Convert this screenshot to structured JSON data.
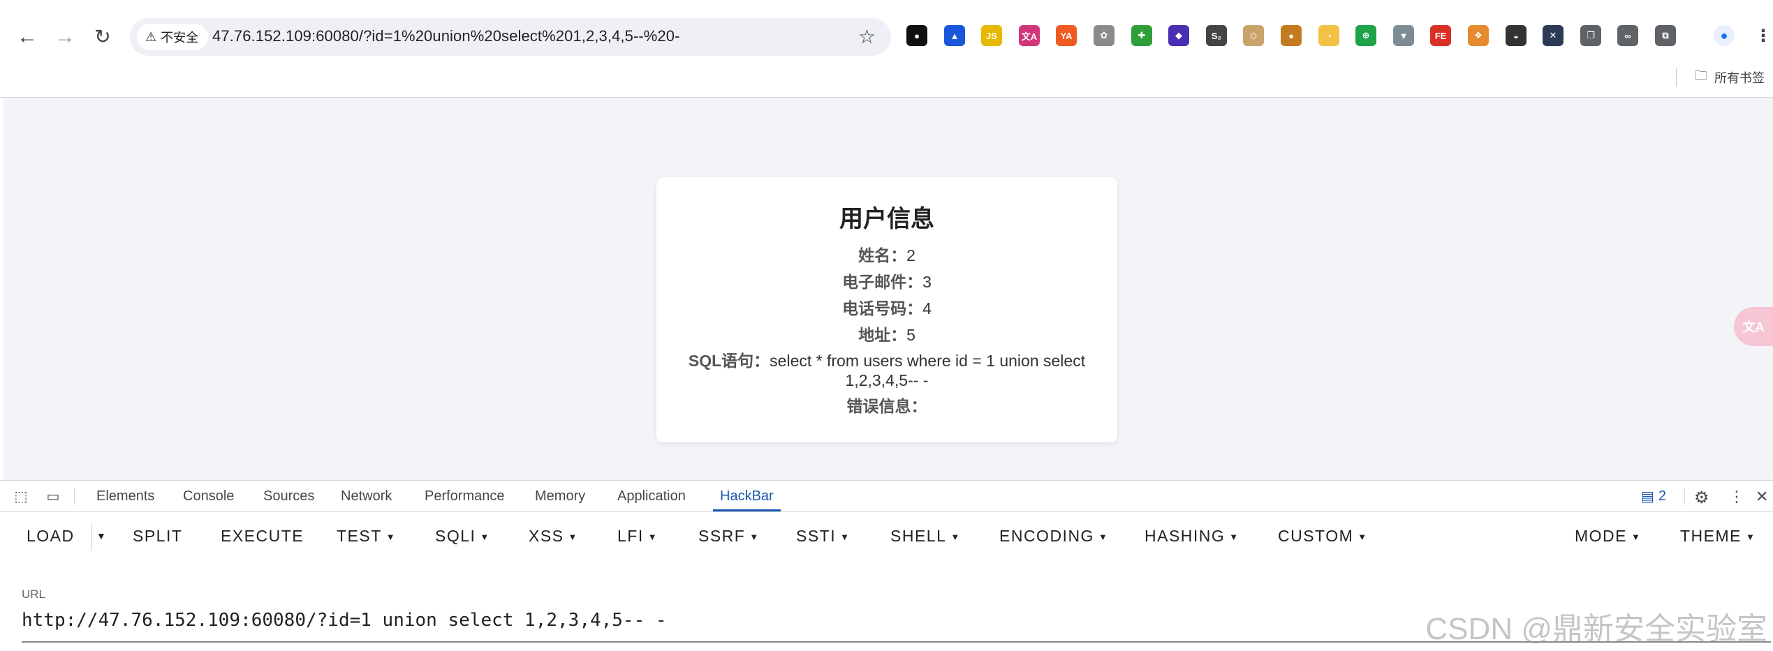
{
  "browser": {
    "security_label": "不安全",
    "url": "47.76.152.109:60080/?id=1%20union%20select%201,2,3,4,5--%20-",
    "bookmarks_label": "所有书签",
    "extensions": [
      {
        "name": "circle-ext-icon",
        "glyph": "●",
        "color": "#111111"
      },
      {
        "name": "triangle-ext-icon",
        "glyph": "▲",
        "color": "#1a56db"
      },
      {
        "name": "js-ext-icon",
        "glyph": "JS",
        "color": "#e6b800"
      },
      {
        "name": "translate-ext-icon",
        "glyph": "文A",
        "color": "#d1367a"
      },
      {
        "name": "ya-ext-icon",
        "glyph": "YA",
        "color": "#f05a22"
      },
      {
        "name": "gecko-ext-icon",
        "glyph": "✿",
        "color": "#8a8a8a"
      },
      {
        "name": "plus-ext-icon",
        "glyph": "✚",
        "color": "#2e9e3a"
      },
      {
        "name": "diamond-ext-icon",
        "glyph": "◆",
        "color": "#4b2fb3"
      },
      {
        "name": "s2-ext-icon",
        "glyph": "S₂",
        "color": "#444444"
      },
      {
        "name": "target-ext-icon",
        "glyph": "◇",
        "color": "#c9a46a"
      },
      {
        "name": "cookie-ext-icon",
        "glyph": "●",
        "color": "#c57a1f"
      },
      {
        "name": "timer-ext-icon",
        "glyph": "◔",
        "color": "#f3c245"
      },
      {
        "name": "green-ext-icon",
        "glyph": "⊕",
        "color": "#1fa34a"
      },
      {
        "name": "v-ext-icon",
        "glyph": "▼",
        "color": "#7d8b94"
      },
      {
        "name": "fe-ext-icon",
        "glyph": "FE",
        "color": "#d93025"
      },
      {
        "name": "wappalyzer-ext-icon",
        "glyph": "❖",
        "color": "#e68a2e"
      },
      {
        "name": "hat-ext-icon",
        "glyph": "◒",
        "color": "#333333"
      },
      {
        "name": "x-ext-icon",
        "glyph": "✕",
        "color": "#2b3a55"
      },
      {
        "name": "copy-ext-icon",
        "glyph": "❐",
        "color": "#5f6368"
      },
      {
        "name": "link-ext-icon",
        "glyph": "∞",
        "color": "#5f6368"
      },
      {
        "name": "puzzle-ext-icon",
        "glyph": "⧉",
        "color": "#5f6368"
      }
    ]
  },
  "page": {
    "title": "用户信息",
    "rows": [
      {
        "label": "姓名：",
        "value": "2"
      },
      {
        "label": "电子邮件：",
        "value": "3"
      },
      {
        "label": "电话号码：",
        "value": "4"
      },
      {
        "label": "地址：",
        "value": "5"
      }
    ],
    "sql_label": "SQL语句：",
    "sql_value": "select * from users where id = 1 union select 1,2,3,4,5-- -",
    "error_label": "错误信息：",
    "error_value": ""
  },
  "devtools": {
    "tabs": [
      "Elements",
      "Console",
      "Sources",
      "Network",
      "Performance",
      "Memory",
      "Application",
      "HackBar"
    ],
    "active_tab": "HackBar",
    "issues_count": "2"
  },
  "hackbar": {
    "load": "LOAD",
    "split": "SPLIT",
    "execute": "EXECUTE",
    "menus": [
      "TEST",
      "SQLI",
      "XSS",
      "LFI",
      "SSRF",
      "SSTI",
      "SHELL",
      "ENCODING",
      "HASHING",
      "CUSTOM"
    ],
    "mode": "MODE",
    "theme": "THEME",
    "url_label": "URL",
    "url_value": "http://47.76.152.109:60080/?id=1 union select 1,2,3,4,5-- -"
  },
  "watermark": "CSDN @鼎新安全实验室"
}
